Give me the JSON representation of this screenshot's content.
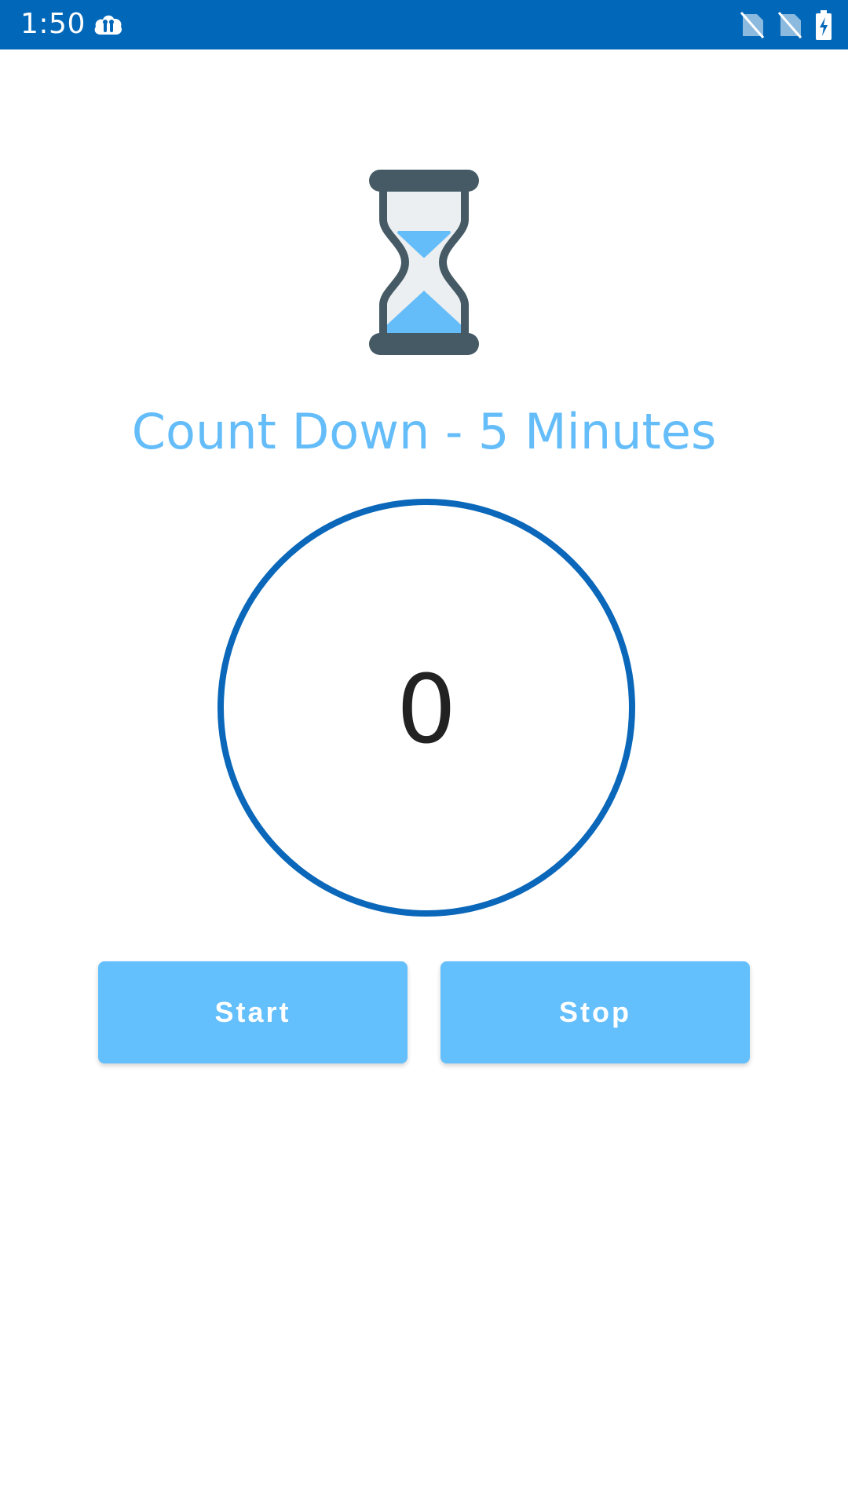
{
  "status_bar": {
    "time": "1:50",
    "app_icon": "cloud-chat-icon",
    "right_icons": [
      "no-sim-icon",
      "no-sim-icon",
      "battery-charging-icon"
    ],
    "bg_color": "#0067b9"
  },
  "app": {
    "hero_icon": "hourglass-icon",
    "title": "Count Down - 5 Minutes",
    "timer_value": "0",
    "buttons": {
      "start_label": "Start",
      "stop_label": "Stop"
    },
    "colors": {
      "accent": "#64bdf9",
      "ring": "#0a67b9",
      "button_bg": "#64bffd"
    }
  }
}
